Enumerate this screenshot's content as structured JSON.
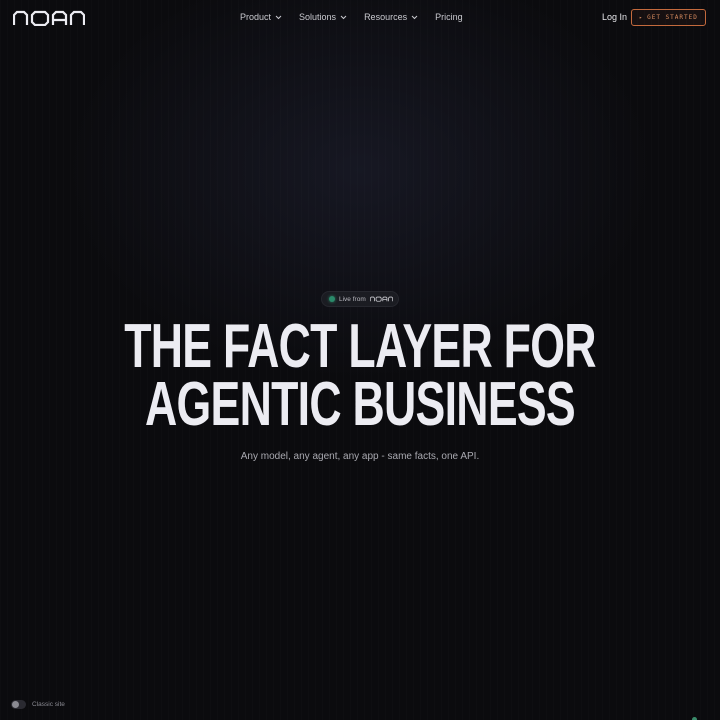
{
  "brand": {
    "logo_text": "noan",
    "logo_icon": "noan-wordmark"
  },
  "nav": {
    "items": [
      {
        "label": "Product",
        "icon": "chevron-down-icon"
      },
      {
        "label": "Solutions",
        "icon": "chevron-down-icon"
      },
      {
        "label": "Resources",
        "icon": "chevron-down-icon"
      },
      {
        "label": "Pricing"
      }
    ],
    "login_label": "Log In",
    "cta_label": "GET STARTED",
    "cta_icon": "arrow-right-icon"
  },
  "hero": {
    "badge_prefix": "Live from",
    "badge_logo_text": "noan",
    "title_line1": "THE FACT LAYER FOR",
    "title_line2": "AGENTIC BUSINESS",
    "subtitle": "Any model, any agent, any app - same facts, one API."
  },
  "footer": {
    "classic_label": "Classic site",
    "classic_toggle_on": false
  },
  "colors": {
    "background": "#0b0b0e",
    "accent": "#c46a3d",
    "live_dot": "#2a8a6a",
    "title_text": "#ececf2"
  }
}
